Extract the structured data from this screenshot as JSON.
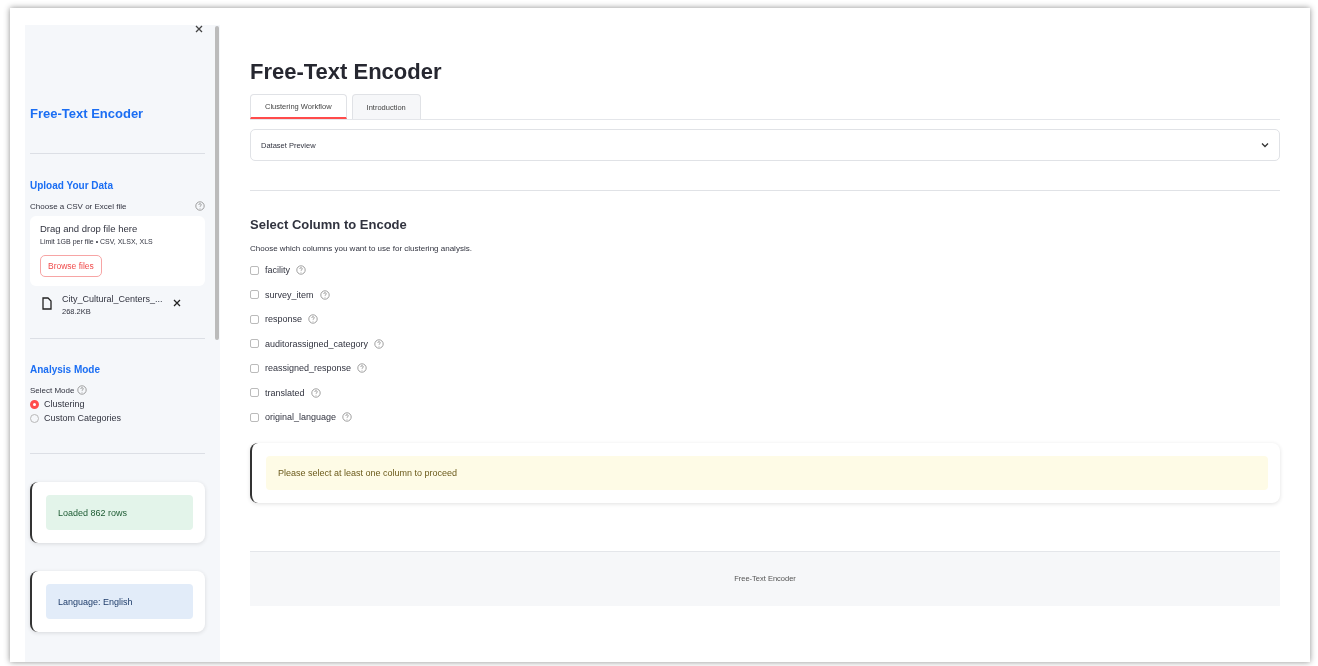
{
  "sidebar": {
    "title": "Free-Text Encoder",
    "upload": {
      "heading": "Upload Your Data",
      "label": "Choose a CSV or Excel file",
      "dropzone_title": "Drag and drop file here",
      "dropzone_hint": "Limit 1GB per file • CSV, XLSX, XLS",
      "browse_button": "Browse files",
      "file": {
        "name": "City_Cultural_Centers_...",
        "size": "268.2KB"
      }
    },
    "analysis": {
      "heading": "Analysis Mode",
      "label": "Select Mode",
      "options": [
        {
          "label": "Clustering",
          "selected": true
        },
        {
          "label": "Custom Categories",
          "selected": false
        }
      ]
    },
    "alerts": [
      {
        "text": "Loaded 862 rows",
        "kind": "success"
      },
      {
        "text": "Language: English",
        "kind": "info"
      }
    ]
  },
  "main": {
    "title": "Free-Text Encoder",
    "tabs": [
      {
        "label": "Clustering Workflow",
        "selected": true
      },
      {
        "label": "Introduction",
        "selected": false
      }
    ],
    "expander": {
      "label": "Dataset Preview",
      "expanded": false
    },
    "section": {
      "heading": "Select Column to Encode",
      "description": "Choose which columns you want to use for clustering analysis.",
      "columns": [
        {
          "label": "facility",
          "checked": false
        },
        {
          "label": "survey_item",
          "checked": false
        },
        {
          "label": "response",
          "checked": false
        },
        {
          "label": "auditorassigned_category",
          "checked": false
        },
        {
          "label": "reassigned_response",
          "checked": false
        },
        {
          "label": "translated",
          "checked": false
        },
        {
          "label": "original_language",
          "checked": false
        }
      ]
    },
    "alert": {
      "text": "Please select at least one column to proceed",
      "kind": "warning"
    },
    "footer": "Free-Text Encoder"
  }
}
